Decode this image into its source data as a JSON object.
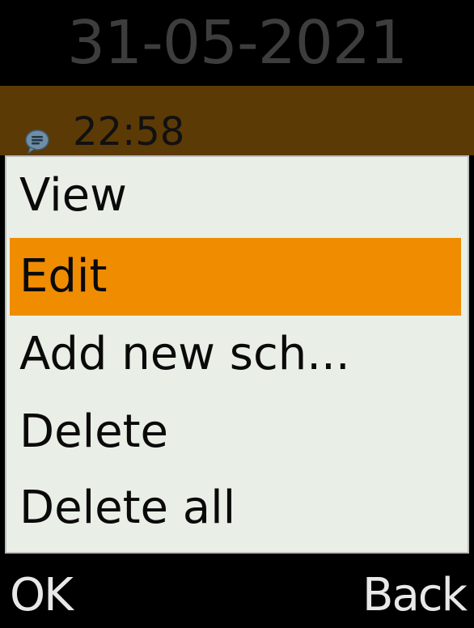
{
  "header": {
    "date": "31-05-2021"
  },
  "event": {
    "icon": "chat-bubble-icon",
    "time": "22:58"
  },
  "menu": {
    "items": [
      {
        "label": "View"
      },
      {
        "label": "Edit"
      },
      {
        "label": "Add new sch..."
      },
      {
        "label": "Delete"
      },
      {
        "label": "Delete all"
      }
    ],
    "selected_index": 1
  },
  "softkeys": {
    "left": "OK",
    "right": "Back"
  },
  "colors": {
    "header_bg": "#000000",
    "event_bg": "#5c3a05",
    "menu_bg": "#e9efe6",
    "selected_bg": "#f08c00",
    "softkey_text": "#e8e8e8"
  }
}
